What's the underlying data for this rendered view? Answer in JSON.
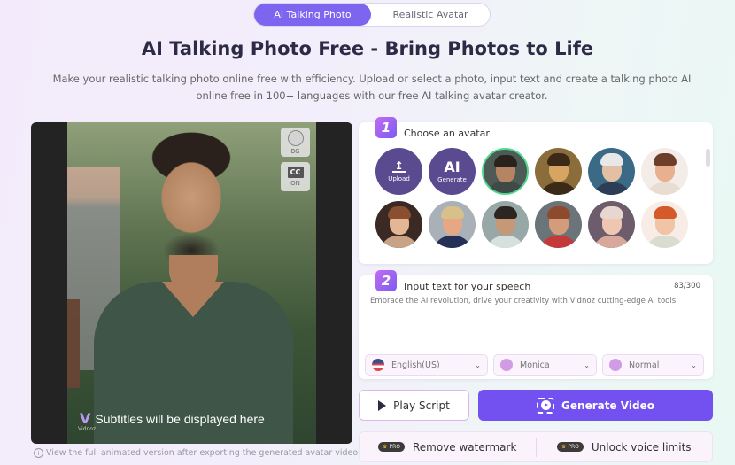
{
  "tabs": [
    {
      "label": "AI Talking Photo",
      "active": true
    },
    {
      "label": "Realistic Avatar",
      "active": false
    }
  ],
  "header": {
    "title": "AI Talking Photo Free - Bring Photos to Life",
    "subtitle": "Make your realistic talking photo online free with efficiency. Upload or select a photo, input text and create a talking photo AI online free in 100+ languages with our free AI talking avatar creator."
  },
  "preview": {
    "bg_button_label": "BG",
    "cc_icon_text": "CC",
    "cc_button_label": "ON",
    "logo_letter": "V",
    "logo_text": "Vidnoz",
    "caption": "Subtitles will be displayed here",
    "info_icon": "i",
    "note": "View the full animated version after exporting the generated avatar video."
  },
  "step1": {
    "number": "1",
    "label": "Choose an avatar",
    "upload": {
      "icon": "↥",
      "label": "Upload"
    },
    "generate": {
      "big": "AI",
      "label": "Generate"
    },
    "avatars": [
      {
        "name": "bearded-man",
        "selected": true,
        "bg": "#4e5a55",
        "skin": "#b58563",
        "hair": "#2a221d",
        "shirt": "#3f4a46"
      },
      {
        "name": "mona-lisa",
        "selected": false,
        "bg": "#8a6d3b",
        "skin": "#d6a562",
        "hair": "#3b2a18",
        "shirt": "#3b2a18"
      },
      {
        "name": "einstein",
        "selected": false,
        "bg": "#3a6a86",
        "skin": "#e3c0a4",
        "hair": "#e8e8e8",
        "shirt": "#2c3d55"
      },
      {
        "name": "cartoon-boy",
        "selected": false,
        "bg": "#f4ece8",
        "skin": "#e8b08e",
        "hair": "#6d3f2a",
        "shirt": "#e9ddd1"
      },
      {
        "name": "cartoon-girl-brunette",
        "selected": false,
        "bg": "#3b2a24",
        "skin": "#e5b693",
        "hair": "#8a4e30",
        "shirt": "#c9a387"
      },
      {
        "name": "trump",
        "selected": false,
        "bg": "#aab0b8",
        "skin": "#e5a882",
        "hair": "#d8c08a",
        "shirt": "#253056"
      },
      {
        "name": "ronaldo",
        "selected": false,
        "bg": "#98a8a6",
        "skin": "#c79877",
        "hair": "#2c2522",
        "shirt": "#d6e0dc"
      },
      {
        "name": "messi",
        "selected": false,
        "bg": "#6b7478",
        "skin": "#d49c7b",
        "hair": "#8d4a2c",
        "shirt": "#c43a3a"
      },
      {
        "name": "ariana",
        "selected": false,
        "bg": "#6d5c6c",
        "skin": "#efc6b2",
        "hair": "#e8d6d0",
        "shirt": "#d8a99a"
      },
      {
        "name": "cartoon-girl-redhead",
        "selected": false,
        "bg": "#f7ede6",
        "skin": "#f0c4a4",
        "hair": "#d55a2a",
        "shirt": "#d9dccf"
      }
    ]
  },
  "step2": {
    "number": "2",
    "label": "Input text for your speech",
    "counter": "83/300",
    "text": "Embrace the AI revolution, drive your creativity with Vidnoz cutting-edge AI tools.",
    "language": "English(US)",
    "voice": "Monica",
    "mood": "Normal",
    "chevron": "⌄"
  },
  "actions": {
    "play_label": "Play Script",
    "generate_label": "Generate Video"
  },
  "pro": {
    "badge_crown": "♛",
    "badge_text": "PRO",
    "remove_watermark": "Remove watermark",
    "unlock_voice": "Unlock voice limits"
  },
  "colors": {
    "accent": "#7d65f0",
    "generate_button": "#7251f0",
    "avatar_tool_bg": "#5a4a8f",
    "selected_ring": "#4fd98e"
  }
}
